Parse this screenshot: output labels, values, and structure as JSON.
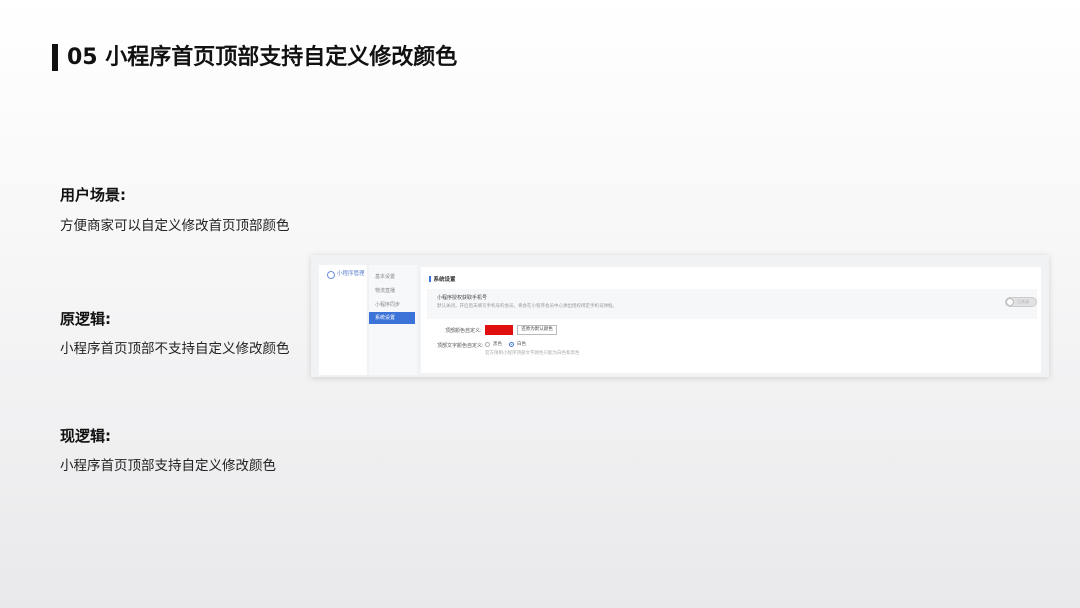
{
  "slide": {
    "title": "05 小程序首页顶部支持自定义修改颜色"
  },
  "sections": [
    {
      "label": "用户场景:",
      "text": "方便商家可以自定义修改首页顶部颜色"
    },
    {
      "label": "原逻辑:",
      "text": "小程序首页顶部不支持自定义修改颜色"
    },
    {
      "label": "现逻辑:",
      "text": "小程序首页顶部支持自定义修改颜色"
    }
  ],
  "screenshot": {
    "brand": "小程序管理",
    "menu": [
      "基本设置",
      "物流直播",
      "小程序同步",
      "系统设置"
    ],
    "active_menu_index": 3,
    "section_title": "系统设置",
    "option_title": "小程序授权获取手机号",
    "option_desc": "默认关闭，开启后未填写手机号的会员，将会在小程序会员中心弹出授权绑定手机号弹框。",
    "toggle_label": "已关闭",
    "color_label": "顶部颜色自定义:",
    "color_value": "#e01010",
    "reset_button": "还原为默认颜色",
    "font_color_label": "顶部文字颜色自定义:",
    "radio_options": [
      "黑色",
      "白色"
    ],
    "radio_selected_index": 1,
    "hint": "官方限制小程序顶部文字颜色只能为白色和黑色"
  },
  "colors": {
    "accent": "#3c73d8",
    "swatch": "#e01010"
  }
}
